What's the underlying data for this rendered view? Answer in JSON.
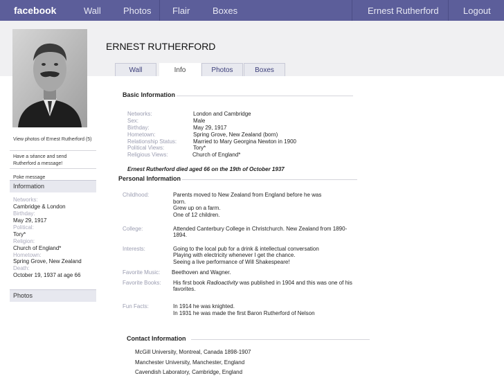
{
  "topbar": {
    "logo": "facebook",
    "nav": [
      "Wall",
      "Photos",
      "Flair",
      "Boxes"
    ],
    "user": "Ernest Rutherford",
    "logout": "Logout"
  },
  "profile": {
    "name": "ERNEST RUTHERFORD",
    "tabs": [
      "Wall",
      "Info",
      "Photos",
      "Boxes"
    ],
    "active_tab": "Info"
  },
  "sidebar": {
    "view_photos": "View photos of Ernest Rutherford (5)",
    "seance": "Have a séance and send Rutherford a message!",
    "poke": "Poke message",
    "information_title": "Information",
    "info": [
      {
        "label": "Networks:",
        "value": "Cambridge & London"
      },
      {
        "label": "Birthday:",
        "value": "May 29, 1917"
      },
      {
        "label": "Political:",
        "value": "Tory*"
      },
      {
        "label": "Religion:",
        "value": "Church of England*"
      },
      {
        "label": "Hometown:",
        "value": "Spring Grove,  New Zealand"
      },
      {
        "label": "Death:",
        "value": "October 19, 1937 at age 66"
      }
    ],
    "photos_title": "Photos"
  },
  "basic": {
    "title": "Basic Information",
    "rows": [
      {
        "label": "Networks:",
        "value": "London and Cambridge"
      },
      {
        "label": "Sex:",
        "value": "Male"
      },
      {
        "label": "Birthday:",
        "value": "May 29, 1917"
      },
      {
        "label": "Hometown:",
        "value": "Spring Grove, New Zealand (born)"
      },
      {
        "label": "Relationship Status:",
        "value": "Married to Mary Georgina Newton in 1900"
      },
      {
        "label": "Political Views:",
        "value": "Tory*"
      },
      {
        "label": "Religious Views:",
        "value": "Church of England*"
      }
    ],
    "death_note": "Ernest Rutherford died aged 66 on the 19th of October 1937"
  },
  "personal": {
    "title": "Personal Information",
    "childhood_label": "Childhood:",
    "childhood": [
      "Parents moved to New Zealand from England before he was",
      "born.",
      "Grew up on a farm.",
      "One of 12 children."
    ],
    "college_label": "College:",
    "college": [
      "Attended Canterbury College in Christchurch. New Zealand from 1890-",
      "1894."
    ],
    "interests_label": "Interests:",
    "interests": [
      "Going to the local pub for a drink & intellectual conversation",
      "Playing with electricity whenever I get the chance.",
      "Seeing a live performance of Will Shakespeare!"
    ],
    "music_label": "Favorite Music:",
    "music": "Beethoven and Wagner.",
    "books_label": "Favorite Books:",
    "books_pre": "His first book ",
    "books_italic": "Radioactivity",
    "books_post": " was published in 1904 and this was one of his",
    "books_line2": "favorites.",
    "funfacts_label": "Fun Facts:",
    "funfacts": [
      "In 1914 he was knighted.",
      "In 1931 he was made the first Baron Rutherford of Nelson"
    ]
  },
  "contact": {
    "title": "Contact Information",
    "lines": [
      "McGill University, Montreal, Canada 1898-1907",
      "Manchester University, Manchester, England",
      "Cavendish Laboratory,  Cambridge, England"
    ]
  }
}
